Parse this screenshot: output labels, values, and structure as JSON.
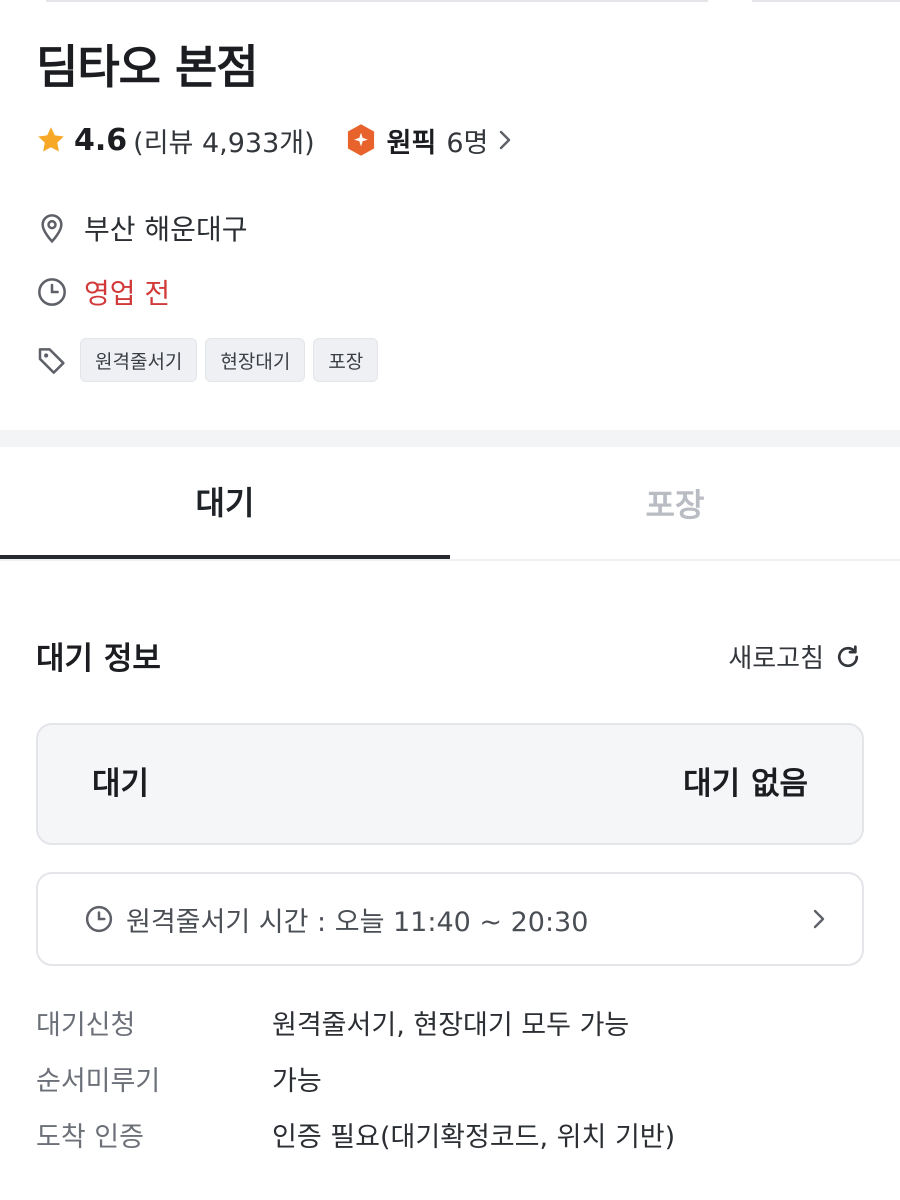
{
  "store": {
    "name": "딤타오 본점",
    "rating": "4.6",
    "review_text": "(리뷰 4,933개)",
    "pick_label": "원픽",
    "pick_count": "6명",
    "address": "부산 해운대구",
    "status": "영업 전",
    "tags": [
      "원격줄서기",
      "현장대기",
      "포장"
    ]
  },
  "tabs": [
    {
      "label": "대기",
      "active": true
    },
    {
      "label": "포장",
      "active": false
    }
  ],
  "wait_info": {
    "title": "대기 정보",
    "refresh_label": "새로고침",
    "wait_label": "대기",
    "wait_value": "대기 없음",
    "remote_time_text": "원격줄서기 시간 : 오늘 11:40 ~ 20:30",
    "details": [
      {
        "key": "대기신청",
        "value": "원격줄서기, 현장대기 모두 가능"
      },
      {
        "key": "순서미루기",
        "value": "가능"
      },
      {
        "key": "도착 인증",
        "value": "인증 필요(대기확정코드, 위치 기반)"
      }
    ]
  },
  "colors": {
    "star": "#f6a826",
    "pick_badge": "#e8632c",
    "closed_status": "#d23a3a",
    "icon_gray": "#5e6168"
  },
  "icons": {
    "rating": "star-icon",
    "pick": "pick-badge-icon",
    "address": "location-pin-icon",
    "hours": "clock-icon",
    "tags": "tag-icon",
    "refresh": "refresh-icon",
    "expand": "chevron-right-icon"
  }
}
